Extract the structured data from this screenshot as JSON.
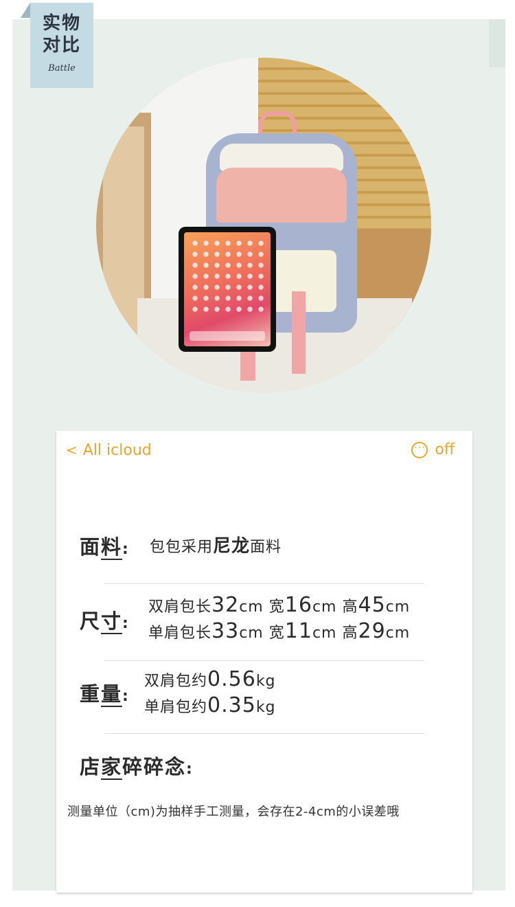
{
  "tag": {
    "title_line1": "实物",
    "title_line2": "对比",
    "subtitle": "Battle"
  },
  "nav": {
    "back_chevron": "<",
    "back_label": "All icloud",
    "more_icon": "dots-icon",
    "off_label": "off"
  },
  "material": {
    "label_a": "面",
    "label_b": "料",
    "colon": ":",
    "text_pre": "包包采用",
    "text_big": "尼龙",
    "text_post": "面料"
  },
  "size": {
    "label_a": "尺",
    "label_b": "寸",
    "colon": ":",
    "line1": {
      "a": "双肩包长",
      "v1": "32",
      "u1": "cm",
      "b": "宽",
      "v2": "16",
      "u2": "cm",
      "c": "高",
      "v3": "45",
      "u3": "cm"
    },
    "line2": {
      "a": "单肩包长",
      "v1": "33",
      "u1": "cm",
      "b": "宽",
      "v2": "11",
      "u2": "cm",
      "c": "高",
      "v3": "29",
      "u3": "cm"
    }
  },
  "weight": {
    "label_a": "重",
    "label_b": "量",
    "colon": ":",
    "line1": {
      "a": "双肩包约",
      "v": "0.56",
      "u": "kg"
    },
    "line2": {
      "a": "单肩包约",
      "v": "0.35",
      "u": "kg"
    }
  },
  "notes": {
    "label_a": "店",
    "label_b": "家",
    "label_c": "碎碎念",
    "colon": ":",
    "text": "测量单位（cm)为抽样手工测量，会存在2-4cm的小误差哦"
  }
}
